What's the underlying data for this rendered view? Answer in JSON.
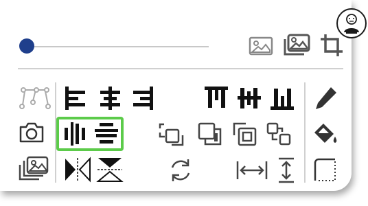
{
  "toolbar": {
    "slider": {
      "value": 0.0
    },
    "top_icons": [
      "image-outline-icon",
      "image-stack-icon",
      "crop-icon"
    ],
    "left_column": [
      "bezier-nodes-icon",
      "camera-icon",
      "image-gallery-icon"
    ],
    "align_group": [
      "align-left-icon",
      "align-center-icon",
      "align-right-icon"
    ],
    "valign_group": [
      "align-top-icon",
      "align-middle-icon",
      "align-bottom-icon"
    ],
    "distribute_group": [
      "distribute-horizontal-icon",
      "distribute-vertical-icon"
    ],
    "arrange_group": [
      "bring-forward-icon",
      "send-backward-icon",
      "bring-to-front-icon",
      "send-to-back-icon"
    ],
    "flip_group": [
      "flip-horizontal-icon",
      "flip-vertical-icon"
    ],
    "transform_group": [
      "rotate-icon",
      "width-icon",
      "height-icon"
    ],
    "right_column": [
      "pencil-icon",
      "paint-bucket-icon",
      "dotted-corner-icon"
    ],
    "accent_color": "#5ccb4a",
    "slider_color": "#1f3f8c"
  }
}
